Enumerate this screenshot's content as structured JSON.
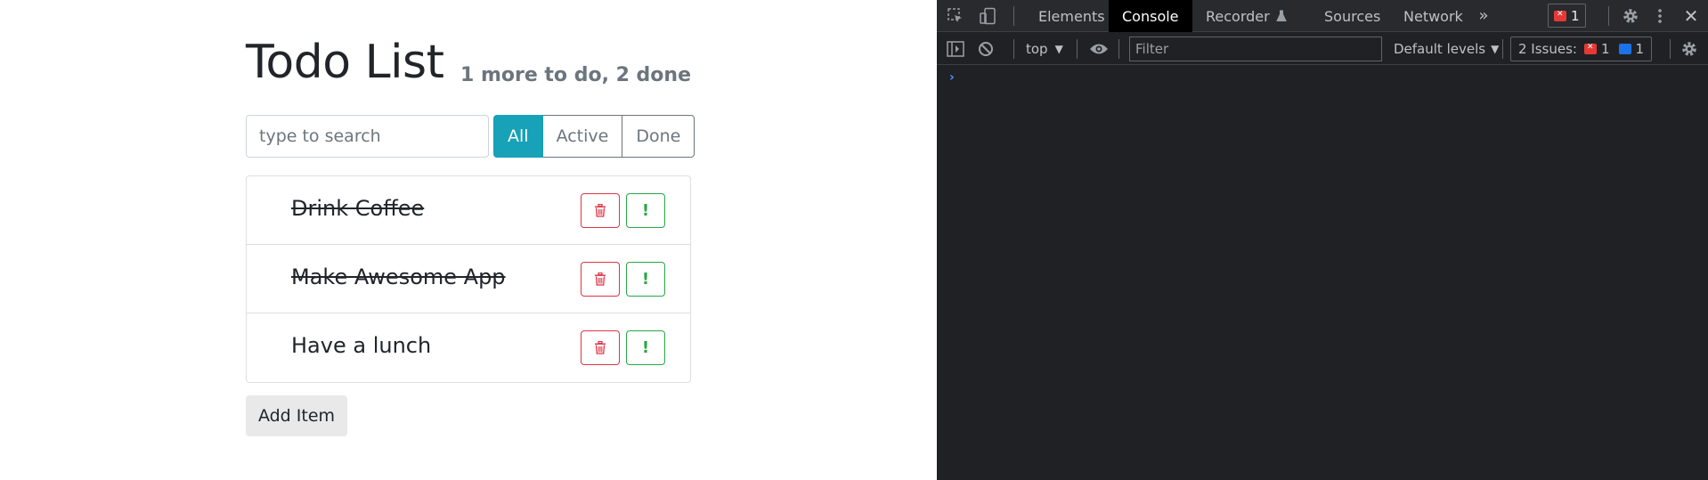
{
  "app": {
    "title": "Todo List",
    "counter": "1 more to do, 2 done",
    "search_placeholder": "type to search",
    "filters": [
      "All",
      "Active",
      "Done"
    ],
    "active_filter": "All",
    "items": [
      {
        "label": "Drink Coffee",
        "done": true
      },
      {
        "label": "Make Awesome App",
        "done": true
      },
      {
        "label": "Have a lunch",
        "done": false
      }
    ],
    "delete_icon": "trash-icon",
    "important_mark": "!",
    "add_button": "Add Item"
  },
  "devtools": {
    "tabs": [
      "Elements",
      "Console",
      "Recorder",
      "Sources",
      "Network"
    ],
    "selected_tab": "Console",
    "error_count": "1",
    "context": "top",
    "filter_placeholder": "Filter",
    "levels": "Default levels",
    "issues_label": "2 Issues:",
    "issues_error_count": "1",
    "issues_info_count": "1",
    "console_prompt": "›"
  },
  "colors": {
    "accent": "#17a2b8",
    "danger": "#dc3545",
    "success": "#28a745",
    "devtools_bg": "#202124"
  }
}
